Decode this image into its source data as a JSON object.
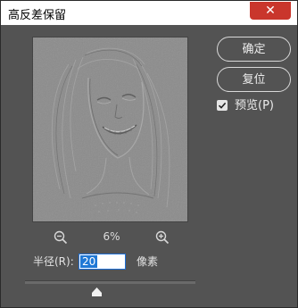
{
  "window": {
    "title": "高反差保留",
    "close_glyph": "✕"
  },
  "preview": {
    "zoom_level": "6%",
    "zoom_out_icon": "zoom-out-icon",
    "zoom_in_icon": "zoom-in-icon"
  },
  "buttons": {
    "ok_label": "确定",
    "reset_label": "复位"
  },
  "preview_checkbox": {
    "label": "预览(P)",
    "checked": true
  },
  "radius": {
    "label": "半径(R):",
    "value": "20",
    "unit": "像素",
    "slider_fraction": 0.42
  },
  "colors": {
    "dialog_bg": "#535353",
    "close_red": "#c9362c",
    "accent_blue": "#1f78d6"
  }
}
